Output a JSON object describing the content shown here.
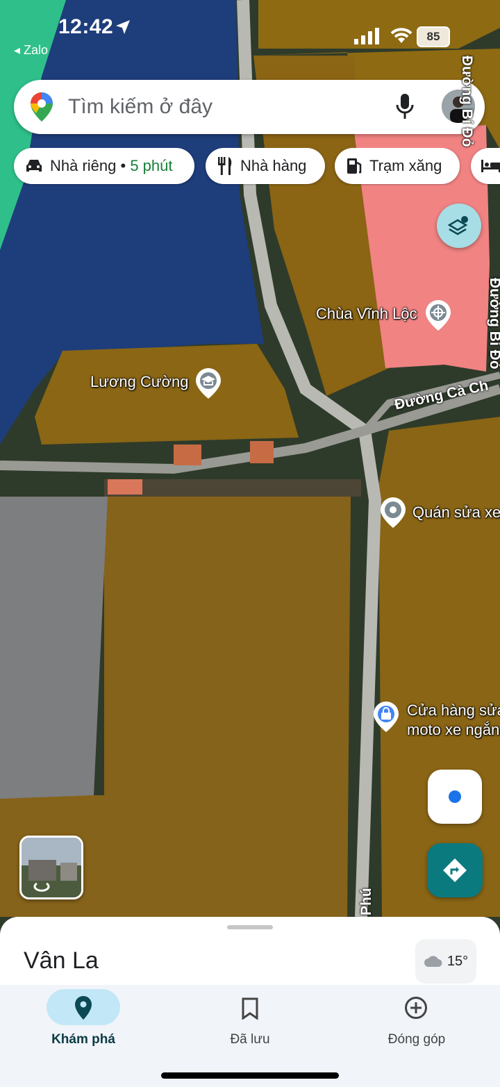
{
  "status_bar": {
    "time": "12:42",
    "back_app": "◂ Zalo",
    "battery": "85"
  },
  "search": {
    "placeholder": "Tìm kiếm ở đây"
  },
  "chips": [
    {
      "label": "Nhà riêng",
      "extra": "5 phút",
      "icon": "car-icon"
    },
    {
      "label": "Nhà hàng",
      "icon": "restaurant-icon"
    },
    {
      "label": "Trạm xăng",
      "icon": "gas-station-icon"
    },
    {
      "label": "",
      "icon": "hotel-icon"
    }
  ],
  "map": {
    "pois": {
      "chua": "Chùa Vĩnh Lộc",
      "luong": "Lương Cường",
      "quan_sua": "Quán sửa xe",
      "cua_hang_1": "Cửa hàng sửa",
      "cua_hang_2": "moto xe ngắn"
    },
    "roads": {
      "ca_ch": "Đường Cà Ch",
      "bi_do": "Đường Bí Đỏ",
      "top_right": "Đường Bí Đỏ",
      "phu": "Phú"
    },
    "zone_colors": {
      "blue": "#1f3a8a",
      "green": "#2fbf8a",
      "ochre": "#9a6a10",
      "pink": "#f08080",
      "gray": "#808080"
    }
  },
  "sheet": {
    "place_name": "Vân La",
    "temperature": "15°"
  },
  "bottom_nav": {
    "items": [
      {
        "label": "Khám phá",
        "icon": "explore-pin-icon",
        "active": true
      },
      {
        "label": "Đã lưu",
        "icon": "bookmark-icon",
        "active": false
      },
      {
        "label": "Đóng góp",
        "icon": "add-circle-icon",
        "active": false
      }
    ]
  },
  "accent_color": "#1a73e8",
  "directions_color": "#00796b"
}
